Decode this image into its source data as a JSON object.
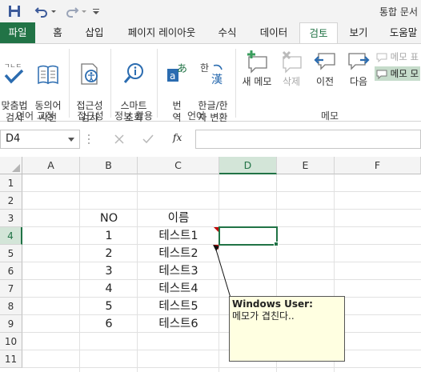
{
  "window": {
    "title": "통합 문서"
  },
  "tabs": [
    "파일",
    "홈",
    "삽입",
    "페이지 레이아웃",
    "수식",
    "데이터",
    "검토",
    "보기",
    "도움말"
  ],
  "ribbon": {
    "spelling": "맞춤법\n검사",
    "thesaurus": "동의어\n사전",
    "accessibility": "접근성\n검사",
    "smart_lookup": "스마트\n조회",
    "translate": "번\n역",
    "hanja": "한글/한\n자 변환",
    "new_comment": "새 메모",
    "delete": "삭제",
    "previous": "이전",
    "next": "다음",
    "show_hide_comment": "메모 표",
    "show_all_comments": "메모 모",
    "groups": {
      "proofing": "언어 교정",
      "accessibility": "접근성",
      "insights": "정보 활용",
      "language": "언어",
      "comments": "메모"
    }
  },
  "formula_bar": {
    "name_box": "D4",
    "fx": "fx",
    "formula": ""
  },
  "sheet": {
    "columns": [
      "A",
      "B",
      "C",
      "D",
      "E",
      "F"
    ],
    "rows": [
      "1",
      "2",
      "3",
      "4",
      "5",
      "6",
      "7",
      "8",
      "9",
      "10",
      "11"
    ],
    "selected_cell": "D4",
    "header_row": {
      "no": "NO",
      "name": "이름"
    },
    "data": [
      {
        "no": "1",
        "name": "테스트1"
      },
      {
        "no": "2",
        "name": "테스트2"
      },
      {
        "no": "3",
        "name": "테스트3"
      },
      {
        "no": "4",
        "name": "테스트4"
      },
      {
        "no": "5",
        "name": "테스트5"
      },
      {
        "no": "6",
        "name": "테스트6"
      }
    ]
  },
  "comment": {
    "author": "Windows User:",
    "text": "메모가 겹친다.."
  },
  "colors": {
    "excel_green": "#217346",
    "comment_bg": "#ffffe1",
    "indicator_red": "#c00000"
  }
}
